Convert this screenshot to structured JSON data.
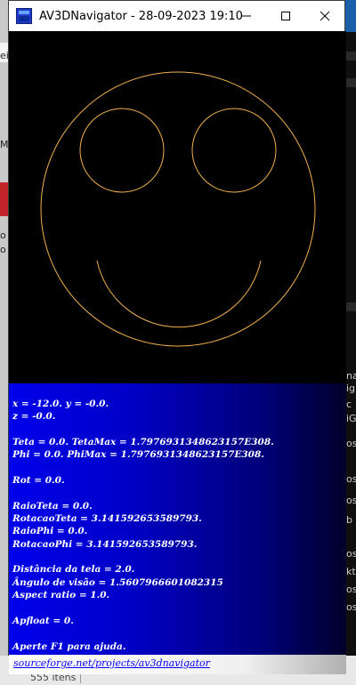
{
  "window": {
    "title": "AV3DNavigator - 28-09-2023 19:10",
    "icons": {
      "app": "app-icon",
      "minimize": "minimize-icon",
      "maximize": "maximize-icon",
      "close": "close-icon"
    }
  },
  "drawing": {
    "stroke_color": "#f0b050",
    "shape": "smiley-face"
  },
  "info": {
    "lines": [
      "x = -12.0. y = -0.0.",
      "z = -0.0.",
      "",
      "Teta = 0.0. TetaMax = 1.7976931348623157E308.",
      "Phi = 0.0. PhiMax = 1.7976931348623157E308.",
      "",
      "Rot = 0.0.",
      "",
      "RaioTeta = 0.0.",
      "RotacaoTeta = 3.141592653589793.",
      "RaioPhi = 0.0.",
      "RotacaoPhi = 3.141592653589793.",
      "",
      "Distância da tela = 2.0.",
      "Ângulo de visão = 1.5607966601082315",
      "Aspect ratio = 1.0.",
      "",
      "Apfloat = 0.",
      "",
      "Aperte F1 para ajuda."
    ],
    "link": "sourceforge.net/projects/av3dnavigator"
  },
  "background": {
    "left_texts": [
      "ei",
      "M",
      "o",
      "o"
    ],
    "right_texts": [
      "na",
      "ig",
      "c",
      "iG",
      "os",
      "os",
      "os",
      "b",
      "os",
      "kt",
      "os",
      "os"
    ],
    "statusbar_count": "555 itens"
  }
}
